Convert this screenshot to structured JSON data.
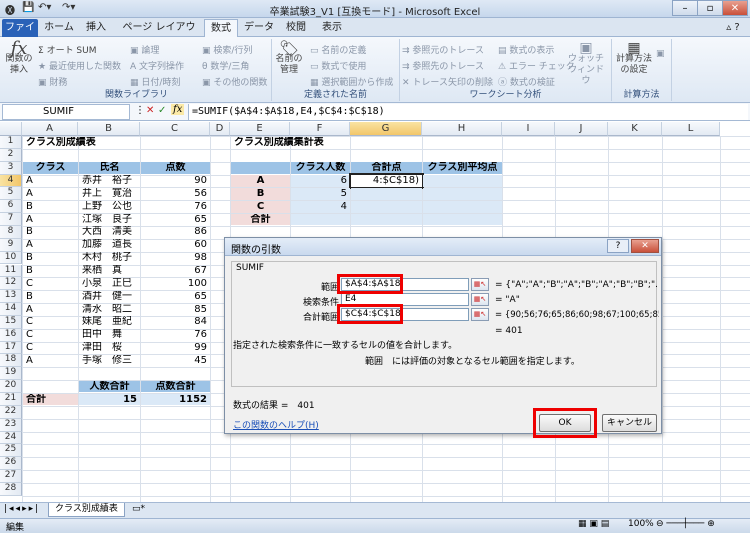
{
  "window": {
    "title": "卒業試験3_V1 [互換モード] - Microsoft Excel"
  },
  "tabs": [
    "ファイル",
    "ホーム",
    "挿入",
    "ページ レイアウト",
    "数式",
    "データ",
    "校閲",
    "表示"
  ],
  "ribbon": {
    "insert_function": "関数の挿入",
    "autosum": "オート SUM",
    "recent": "最近使用した関数",
    "financial": "財務",
    "logical": "論理",
    "text": "文字列操作",
    "datetime": "日付/時刻",
    "lookup": "検索/行列",
    "math": "数学/三角",
    "more": "その他の関数",
    "group_library": "関数ライブラリ",
    "name_manager": "名前の管理",
    "define_name": "名前の定義",
    "use_in_formula": "数式で使用",
    "create_from_sel": "選択範囲から作成",
    "group_names": "定義された名前",
    "trace_prec": "参照元のトレース",
    "trace_dep": "参照先のトレース",
    "remove_arrows": "トレース矢印の削除",
    "show_formulas": "数式の表示",
    "error_check": "エラー チェック",
    "eval_formula": "数式の検証",
    "watch": "ウォッチウィンドウ",
    "group_audit": "ワークシート分析",
    "calc_options": "計算方法の設定",
    "group_calc": "計算方法"
  },
  "formula_bar": {
    "name_box": "SUMIF",
    "formula": "=SUMIF($A$4:$A$18,E4,$C$4:$C$18)"
  },
  "columns": [
    "A",
    "B",
    "C",
    "D",
    "E",
    "F",
    "G",
    "H",
    "I",
    "J",
    "K",
    "L"
  ],
  "rows": [
    "1",
    "2",
    "3",
    "4",
    "5",
    "6",
    "7",
    "8",
    "9",
    "10",
    "11",
    "12",
    "13",
    "14",
    "15",
    "16",
    "17",
    "18",
    "19",
    "20",
    "21",
    "22",
    "23",
    "24",
    "25",
    "26",
    "27",
    "28"
  ],
  "sheet": {
    "title_left": "クラス別成績表",
    "header_class": "クラス",
    "header_name": "氏名",
    "header_score": "点数",
    "records": [
      {
        "cls": "A",
        "name": "赤井　裕子",
        "score": "90"
      },
      {
        "cls": "A",
        "name": "井上　寛治",
        "score": "56"
      },
      {
        "cls": "B",
        "name": "上野　公也",
        "score": "76"
      },
      {
        "cls": "A",
        "name": "江塚　良子",
        "score": "65"
      },
      {
        "cls": "B",
        "name": "大西　清美",
        "score": "86"
      },
      {
        "cls": "A",
        "name": "加藤　道長",
        "score": "60"
      },
      {
        "cls": "B",
        "name": "木村　桃子",
        "score": "98"
      },
      {
        "cls": "B",
        "name": "来栖　真",
        "score": "67"
      },
      {
        "cls": "C",
        "name": "小泉　正巳",
        "score": "100"
      },
      {
        "cls": "B",
        "name": "酒井　健一",
        "score": "65"
      },
      {
        "cls": "A",
        "name": "清水　昭二",
        "score": "85"
      },
      {
        "cls": "C",
        "name": "妹尾　亜紀",
        "score": "84"
      },
      {
        "cls": "C",
        "name": "田中　舞",
        "score": "76"
      },
      {
        "cls": "C",
        "name": "津田　桜",
        "score": "99"
      },
      {
        "cls": "A",
        "name": "手塚　修三",
        "score": "45"
      }
    ],
    "total_count_label": "人数合計",
    "total_score_label": "点数合計",
    "total_label": "合計",
    "total_count": "15",
    "total_score": "1152",
    "title_right": "クラス別成績集計表",
    "sum_h_count": "クラス人数",
    "sum_h_score": "合計点",
    "sum_h_avg": "クラス別平均点",
    "sum_rows": [
      {
        "cls": "A",
        "count": "6",
        "score": "4:$C$18)"
      },
      {
        "cls": "B",
        "count": "5",
        "score": ""
      },
      {
        "cls": "C",
        "count": "4",
        "score": ""
      }
    ],
    "sum_total": "合計"
  },
  "dialog": {
    "title": "関数の引数",
    "help_icon": "?",
    "close": "✕",
    "fn": "SUMIF",
    "arg1_label": "範囲",
    "arg1_value": "$A$4:$A$18",
    "arg1_result": "{\"A\";\"A\";\"B\";\"A\";\"B\";\"A\";\"B\";\"B\";\"...",
    "arg2_label": "検索条件",
    "arg2_value": "E4",
    "arg2_result": "\"A\"",
    "arg3_label": "合計範囲",
    "arg3_value": "$C$4:$C$18",
    "arg3_result": "{90;56;76;65;86;60;98;67;100;65;85;84;76;9",
    "result_value": "= 401",
    "desc": "指定された検索条件に一致するセルの値を合計します。",
    "arg_desc": "範囲　には評価の対象となるセル範囲を指定します。",
    "formula_result": "数式の結果 =　401",
    "help_link": "この関数のヘルプ(H)",
    "ok": "OK",
    "cancel": "キャンセル"
  },
  "sheet_tab": "クラス別成績表",
  "status": {
    "mode": "編集",
    "zoom": "100%"
  }
}
